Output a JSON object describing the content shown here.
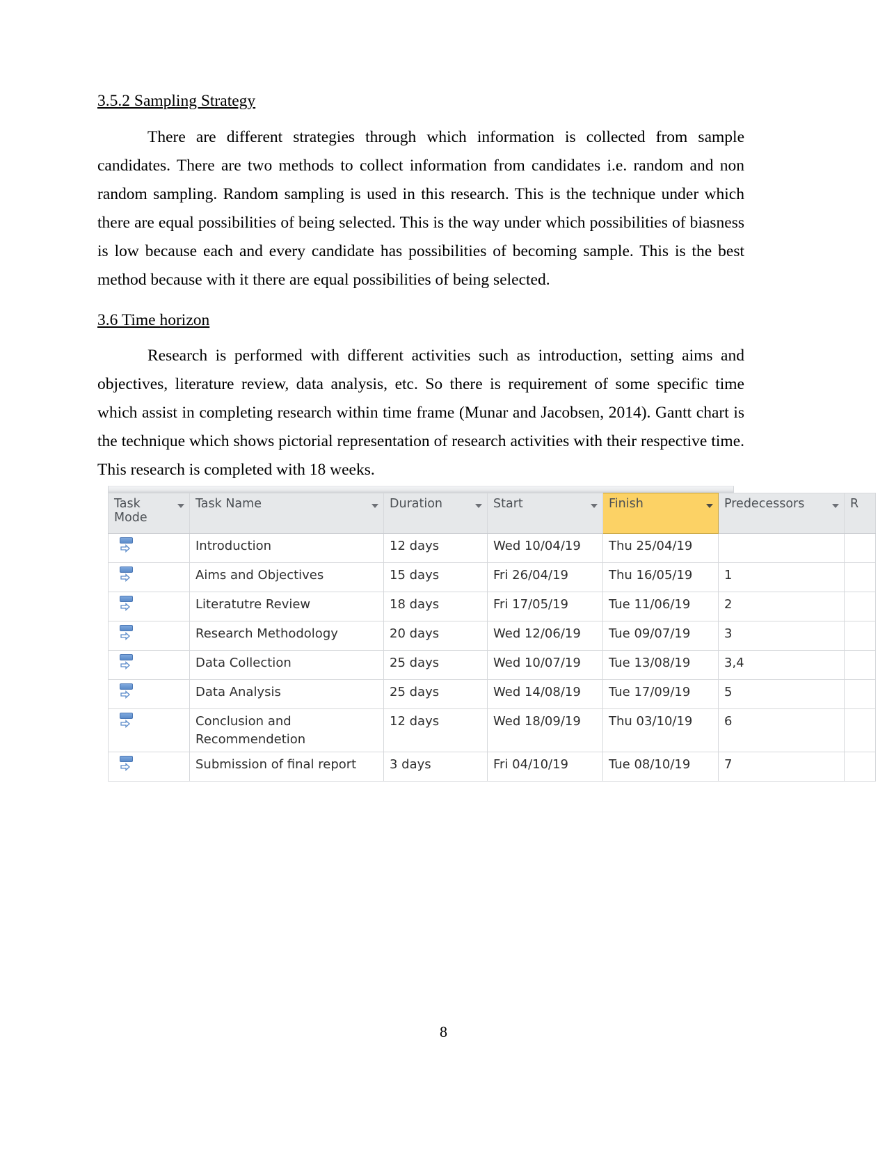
{
  "document": {
    "page_number": "8",
    "sections": [
      {
        "heading": "3.5.2 Sampling Strategy",
        "paragraph": "There are different strategies through which information is collected from sample candidates. There are two methods to collect information from candidates i.e. random and non random sampling. Random sampling is used in this research. This is the technique under which there are equal possibilities of being selected. This is the way under which possibilities of biasness is low because each and every candidate has possibilities of becoming sample. This is the best method because with it there are equal possibilities of being selected."
      },
      {
        "heading": "3.6 Time horizon",
        "paragraph": "Research is performed with different activities such as introduction, setting aims and objectives, literature review, data analysis, etc. So there is requirement of some specific time which assist in completing research within time frame (Munar and Jacobsen, 2014). Gantt chart is the technique which shows pictorial representation of research activities with their respective time. This research is completed with 18 weeks."
      }
    ]
  },
  "gantt_table": {
    "highlighted_column": "Finish",
    "highlight_color": "#fcd265",
    "columns": [
      {
        "key": "task_mode",
        "label": "Task Mode",
        "filter": true
      },
      {
        "key": "task_name",
        "label": "Task Name",
        "filter": true
      },
      {
        "key": "duration",
        "label": "Duration",
        "filter": true
      },
      {
        "key": "start",
        "label": "Start",
        "filter": true
      },
      {
        "key": "finish",
        "label": "Finish",
        "filter": true
      },
      {
        "key": "predecessors",
        "label": "Predecessors",
        "filter": true
      },
      {
        "key": "extra",
        "label": "R",
        "filter": false
      }
    ],
    "rows": [
      {
        "mode_icon": "auto-schedule-icon",
        "task_name": "Introduction",
        "duration": "12 days",
        "start": "Wed 10/04/19",
        "finish": "Thu 25/04/19",
        "predecessors": ""
      },
      {
        "mode_icon": "auto-schedule-icon",
        "task_name": "Aims and Objectives",
        "duration": "15 days",
        "start": "Fri 26/04/19",
        "finish": "Thu 16/05/19",
        "predecessors": "1"
      },
      {
        "mode_icon": "auto-schedule-icon",
        "task_name": "Literatutre Review",
        "duration": "18 days",
        "start": "Fri 17/05/19",
        "finish": "Tue 11/06/19",
        "predecessors": "2"
      },
      {
        "mode_icon": "auto-schedule-icon",
        "task_name": "Research Methodology",
        "duration": "20 days",
        "start": "Wed 12/06/19",
        "finish": "Tue 09/07/19",
        "predecessors": "3"
      },
      {
        "mode_icon": "auto-schedule-icon",
        "task_name": "Data Collection",
        "duration": "25 days",
        "start": "Wed 10/07/19",
        "finish": "Tue 13/08/19",
        "predecessors": "3,4"
      },
      {
        "mode_icon": "auto-schedule-icon",
        "task_name": "Data Analysis",
        "duration": "25 days",
        "start": "Wed 14/08/19",
        "finish": "Tue 17/09/19",
        "predecessors": "5"
      },
      {
        "mode_icon": "auto-schedule-icon",
        "task_name": "Conclusion and Recommendetion",
        "duration": "12 days",
        "start": "Wed 18/09/19",
        "finish": "Thu 03/10/19",
        "predecessors": "6",
        "tall": true
      },
      {
        "mode_icon": "auto-schedule-icon",
        "task_name": "Submission of final report",
        "duration": "3 days",
        "start": "Fri 04/10/19",
        "finish": "Tue 08/10/19",
        "predecessors": "7",
        "tall": true
      }
    ]
  }
}
